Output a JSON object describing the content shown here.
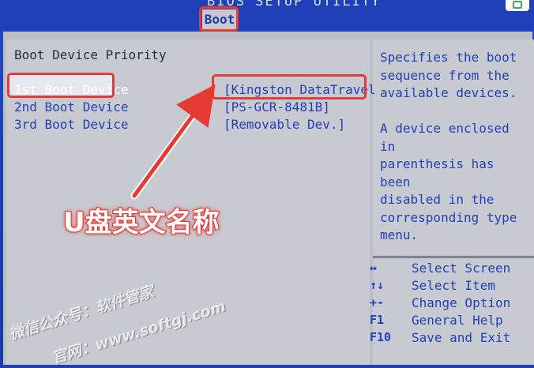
{
  "header": {
    "bios_title": "BIOS SETUP UTILITY",
    "active_tab": "Boot"
  },
  "main": {
    "section_title": "Boot Device Priority",
    "rows": [
      {
        "label": "1st Boot Device",
        "value": "[Kingston DataTravel"
      },
      {
        "label": "2nd Boot Device",
        "value": "[PS-GCR-8481B]"
      },
      {
        "label": "3rd Boot Device",
        "value": "[Removable Dev.]"
      }
    ]
  },
  "help": {
    "text1": "Specifies the boot\nsequence from the\navailable devices.",
    "text2": "A device enclosed in\nparenthesis has been\ndisabled in the\ncorresponding type\nmenu."
  },
  "keys": [
    {
      "key": "↔",
      "desc": "Select Screen"
    },
    {
      "key": "↑↓",
      "desc": "Select Item"
    },
    {
      "key": "+-",
      "desc": "Change Option"
    },
    {
      "key": "F1",
      "desc": "General Help"
    },
    {
      "key": "F10",
      "desc": "Save and Exit"
    }
  ],
  "annotation": {
    "label": "U盘英文名称"
  },
  "watermark": {
    "line1": "微信公众号：软件管家",
    "line2": "官网：www.softgj.com"
  },
  "colors": {
    "bios_blue": "#1f3eb0",
    "panel_gray": "#c8cad1",
    "highlight_red": "#e53b32"
  },
  "icons": [
    "arrow-annotation-icon",
    "app-corner-icon"
  ]
}
